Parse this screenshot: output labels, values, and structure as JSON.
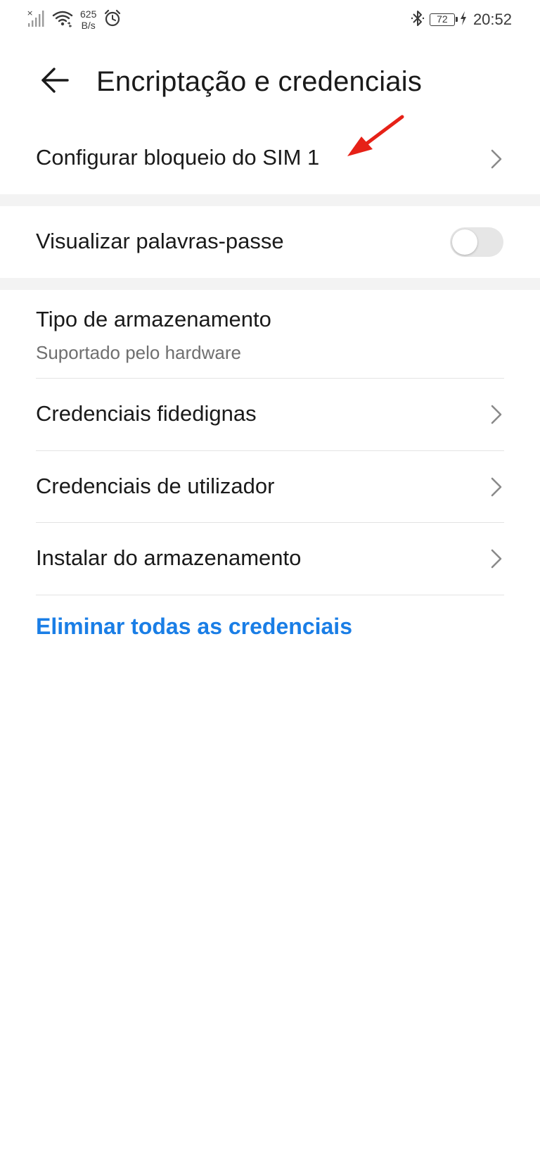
{
  "status_bar": {
    "net_speed_value": "625",
    "net_speed_unit": "B/s",
    "battery_level": "72",
    "time": "20:52",
    "icons": [
      "signal-off-icon",
      "wifi-icon",
      "alarm-icon",
      "bluetooth-icon",
      "battery-icon",
      "charging-icon"
    ]
  },
  "header": {
    "title": "Encriptação e credenciais",
    "back_icon": "arrow-left-icon"
  },
  "settings": {
    "sim_lock": {
      "label": "Configurar bloqueio do SIM 1"
    },
    "show_passwords": {
      "label": "Visualizar palavras-passe",
      "enabled": false
    },
    "storage_type": {
      "label": "Tipo de armazenamento",
      "value": "Suportado pelo hardware"
    },
    "trusted_credentials": {
      "label": "Credenciais fidedignas"
    },
    "user_credentials": {
      "label": "Credenciais de utilizador"
    },
    "install_from_storage": {
      "label": "Instalar do armazenamento"
    },
    "clear_credentials": {
      "label": "Eliminar todas as credenciais"
    }
  },
  "colors": {
    "accent": "#1a7ee6",
    "annotation": "#e62117",
    "toggle_off_track": "#e6e6e6",
    "section_gap": "#f3f3f3"
  }
}
